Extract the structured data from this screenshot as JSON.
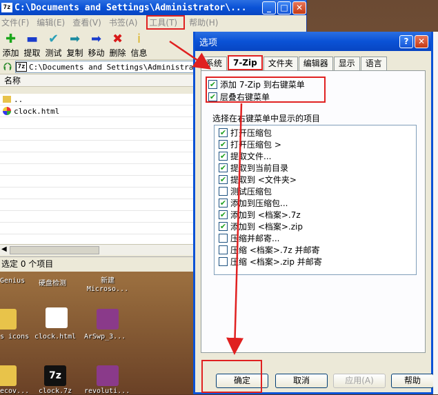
{
  "main_window": {
    "app_icon": "7z",
    "title": "C:\\Documents and Settings\\Administrator\\...",
    "controls": {
      "minimize": "_",
      "maximize": "□",
      "close": "✕"
    },
    "menu": [
      "文件(F)",
      "编辑(E)",
      "查看(V)",
      "书签(A)",
      "工具(T)",
      "帮助(H)"
    ],
    "toolbar": [
      {
        "label": "添加",
        "icon": "add-icon",
        "glyph": "✚",
        "color": "#1aa61a"
      },
      {
        "label": "提取",
        "icon": "extract-icon",
        "glyph": "▬",
        "color": "#1a3ccc"
      },
      {
        "label": "测试",
        "icon": "test-icon",
        "glyph": "✔",
        "color": "#2aa0b8"
      },
      {
        "label": "复制",
        "icon": "copy-icon",
        "glyph": "➡",
        "color": "#1a8aa0"
      },
      {
        "label": "移动",
        "icon": "move-icon",
        "glyph": "➡",
        "color": "#1a3ccc"
      },
      {
        "label": "删除",
        "icon": "delete-icon",
        "glyph": "✖",
        "color": "#d81a1a"
      },
      {
        "label": "信息",
        "icon": "info-icon",
        "glyph": "i",
        "color": "#d8b01a"
      }
    ],
    "address": "C:\\Documents and Settings\\Administrator",
    "address_icon": "7z",
    "column_name": "名称",
    "files": [
      {
        "name": ".."
      },
      {
        "name": "clock.html"
      }
    ],
    "status": "选定 0 个项目"
  },
  "desktop": {
    "labels": [
      {
        "text": "Genius"
      },
      {
        "text": "硬盘检测"
      },
      {
        "text": "新建\nMicroso..."
      },
      {
        "text": "s icons"
      },
      {
        "text": "clock.html"
      },
      {
        "text": "ArSwp_3..."
      },
      {
        "text": "ecov..."
      },
      {
        "text": "clock.7z"
      },
      {
        "text": "revoluti..."
      }
    ]
  },
  "dialog": {
    "title": "选项",
    "controls": {
      "help": "?",
      "close": "✕"
    },
    "tabs": [
      "系统",
      "7-Zip",
      "文件夹",
      "编辑器",
      "显示",
      "语言"
    ],
    "active_tab": "7-Zip",
    "options": [
      {
        "label": "添加 7-Zip 到右键菜单",
        "checked": true
      },
      {
        "label": "层叠右键菜单",
        "checked": true
      }
    ],
    "list_caption": "选择在右键菜单中显示的项目",
    "items": [
      {
        "label": "打开压缩包",
        "checked": true
      },
      {
        "label": "打开压缩包 >",
        "checked": true
      },
      {
        "label": "提取文件...",
        "checked": true
      },
      {
        "label": "提取到当前目录",
        "checked": true
      },
      {
        "label": "提取到 <文件夹>",
        "checked": true
      },
      {
        "label": "测试压缩包",
        "checked": false
      },
      {
        "label": "添加到压缩包...",
        "checked": true
      },
      {
        "label": "添加到 <档案>.7z",
        "checked": true
      },
      {
        "label": "添加到 <档案>.zip",
        "checked": true
      },
      {
        "label": "压缩并邮寄...",
        "checked": false
      },
      {
        "label": "压缩 <档案>.7z 并邮寄",
        "checked": false
      },
      {
        "label": "压缩 <档案>.zip 并邮寄",
        "checked": false
      }
    ],
    "buttons": {
      "ok": "确定",
      "cancel": "取消",
      "apply": "应用(A)",
      "help": "帮助"
    }
  },
  "colors": {
    "highlight": "#e02020",
    "xp_blue": "#0a52d6",
    "check": "#21a121"
  }
}
